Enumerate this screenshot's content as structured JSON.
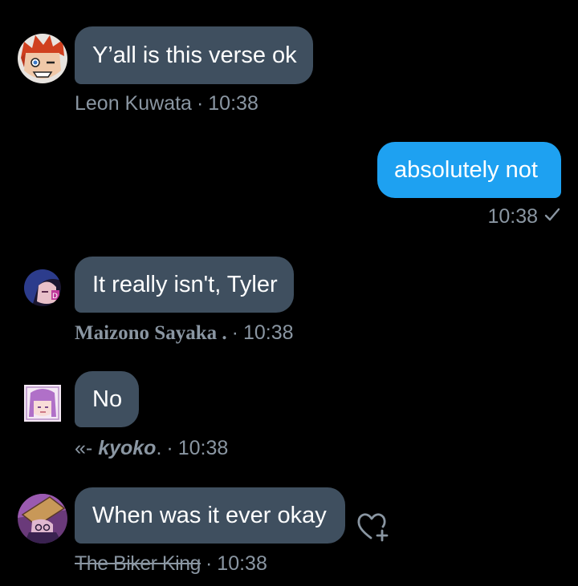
{
  "colors": {
    "background": "#000000",
    "incoming_bubble": "#3f4f5f",
    "outgoing_bubble": "#1ea1f1",
    "meta_text": "#8a96a2"
  },
  "messages": [
    {
      "text": "Y’all is this verse ok",
      "sender": "Leon Kuwata",
      "time": "10:38",
      "avatar": "red-haired-avatar"
    },
    {
      "text": "absolutely not",
      "time": "10:38",
      "status_icon": "checkmark-icon"
    },
    {
      "text": "It really isn't, Tyler",
      "sender": "Maizono Sayaka .",
      "time": "10:38",
      "avatar": "blue-haired-avatar"
    },
    {
      "text": "No",
      "sender_prefix": "«-",
      "sender": "kyoko",
      "sender_suffix": ".",
      "time": "10:38",
      "avatar": "purple-haired-avatar"
    },
    {
      "text": "When was it ever okay",
      "sender": "The Biker King",
      "time": "10:38",
      "avatar": "hat-avatar",
      "reaction_icon": "heart-plus-icon"
    }
  ],
  "separator": "·"
}
